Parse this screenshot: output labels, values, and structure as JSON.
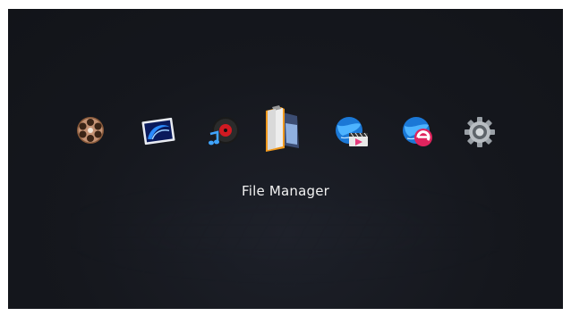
{
  "menu": {
    "selected_label": "File Manager",
    "items": [
      {
        "icon": "movie-reel-icon"
      },
      {
        "icon": "photo-icon"
      },
      {
        "icon": "music-disc-icon"
      },
      {
        "icon": "file-manager-folder-icon",
        "selected": true
      },
      {
        "icon": "web-video-globe-icon"
      },
      {
        "icon": "internet-explorer-globe-icon"
      },
      {
        "icon": "settings-gear-icon"
      }
    ]
  },
  "colors": {
    "background": "#14161b",
    "text": "#f1f1f1",
    "accent_orange": "#f19a1f"
  }
}
